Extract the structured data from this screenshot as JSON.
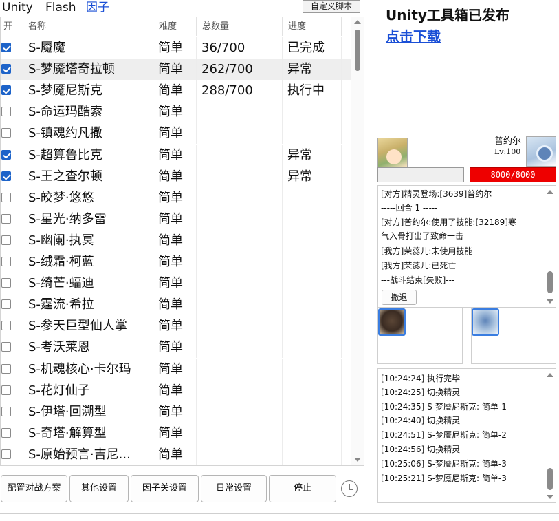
{
  "tabs": [
    {
      "label": "Unity",
      "active": false
    },
    {
      "label": "Flash",
      "active": false
    },
    {
      "label": "因子",
      "active": true
    }
  ],
  "custom_script_label": "自定义脚本",
  "table": {
    "headers": [
      "开",
      "名称",
      "难度",
      "总数量",
      "进度"
    ],
    "rows": [
      {
        "checked": true,
        "name": "S-魇魔",
        "difficulty": "简单",
        "total": "36/700",
        "progress": "已完成"
      },
      {
        "checked": true,
        "name": "S-梦魇塔奇拉顿",
        "difficulty": "简单",
        "total": "262/700",
        "progress": "异常"
      },
      {
        "checked": true,
        "name": "S-梦魇尼斯克",
        "difficulty": "简单",
        "total": "288/700",
        "progress": "执行中"
      },
      {
        "checked": false,
        "name": "S-命运玛酷索",
        "difficulty": "简单",
        "total": "",
        "progress": ""
      },
      {
        "checked": false,
        "name": "S-镇魂约凡撒",
        "difficulty": "简单",
        "total": "",
        "progress": ""
      },
      {
        "checked": true,
        "name": "S-超算鲁比克",
        "difficulty": "简单",
        "total": "",
        "progress": "异常"
      },
      {
        "checked": true,
        "name": "S-王之查尔顿",
        "difficulty": "简单",
        "total": "",
        "progress": "异常"
      },
      {
        "checked": false,
        "name": "S-皎梦·悠悠",
        "difficulty": "简单",
        "total": "",
        "progress": ""
      },
      {
        "checked": false,
        "name": "S-星光·纳多雷",
        "difficulty": "简单",
        "total": "",
        "progress": ""
      },
      {
        "checked": false,
        "name": "S-幽阑·执冥",
        "difficulty": "简单",
        "total": "",
        "progress": ""
      },
      {
        "checked": false,
        "name": "S-绒霜·柯蓝",
        "difficulty": "简单",
        "total": "",
        "progress": ""
      },
      {
        "checked": false,
        "name": "S-绮芒·蝠迪",
        "difficulty": "简单",
        "total": "",
        "progress": ""
      },
      {
        "checked": false,
        "name": "S-霆流·希拉",
        "difficulty": "简单",
        "total": "",
        "progress": ""
      },
      {
        "checked": false,
        "name": "S-参天巨型仙人掌",
        "difficulty": "简单",
        "total": "",
        "progress": ""
      },
      {
        "checked": false,
        "name": "S-考沃莱恩",
        "difficulty": "简单",
        "total": "",
        "progress": ""
      },
      {
        "checked": false,
        "name": "S-机魂核心·卡尔玛",
        "difficulty": "简单",
        "total": "",
        "progress": ""
      },
      {
        "checked": false,
        "name": "S-花灯仙子",
        "difficulty": "简单",
        "total": "",
        "progress": ""
      },
      {
        "checked": false,
        "name": "S-伊塔·回溯型",
        "difficulty": "简单",
        "total": "",
        "progress": ""
      },
      {
        "checked": false,
        "name": "S-奇塔·解算型",
        "difficulty": "简单",
        "total": "",
        "progress": ""
      },
      {
        "checked": false,
        "name": "S-原始预言·吉尼...",
        "difficulty": "简单",
        "total": "",
        "progress": ""
      }
    ]
  },
  "buttons": [
    "配置对战方案",
    "其他设置",
    "因子关设置",
    "日常设置",
    "停止"
  ],
  "promo": {
    "title": "Unity工具箱已发布",
    "link": "点击下载"
  },
  "battle": {
    "enemy_name": "普约尔",
    "enemy_level": "Lv:100",
    "enemy_hp": "8000/8000",
    "log": [
      "[对方]精灵登场:[3639]普约尔",
      "-----回合 1 -----",
      "[对方]普约尔:使用了技能:[32189]寒",
      "气入骨打出了致命一击",
      "[我方]茉蕊儿:未使用技能",
      "[我方]茉蕊儿:已死亡",
      "---战斗结束[失败]---"
    ],
    "retreat_label": "撤退"
  },
  "syslog": [
    "[10:24:24]  执行完毕",
    "[10:24:25] 切换精灵",
    "[10:24:35] S-梦魇尼斯克: 简单-1",
    "[10:24:40] 切换精灵",
    "[10:24:51] S-梦魇尼斯克: 简单-2",
    "[10:24:56] 切换精灵",
    "[10:25:06] S-梦魇尼斯克: 简单-3",
    "[10:25:21] S-梦魇尼斯克: 简单-3"
  ],
  "colors": {
    "accent": "#1d63c9",
    "link": "#1a4fd6",
    "hp": "#ee0000"
  },
  "icons": {
    "clock": "clock-icon"
  }
}
